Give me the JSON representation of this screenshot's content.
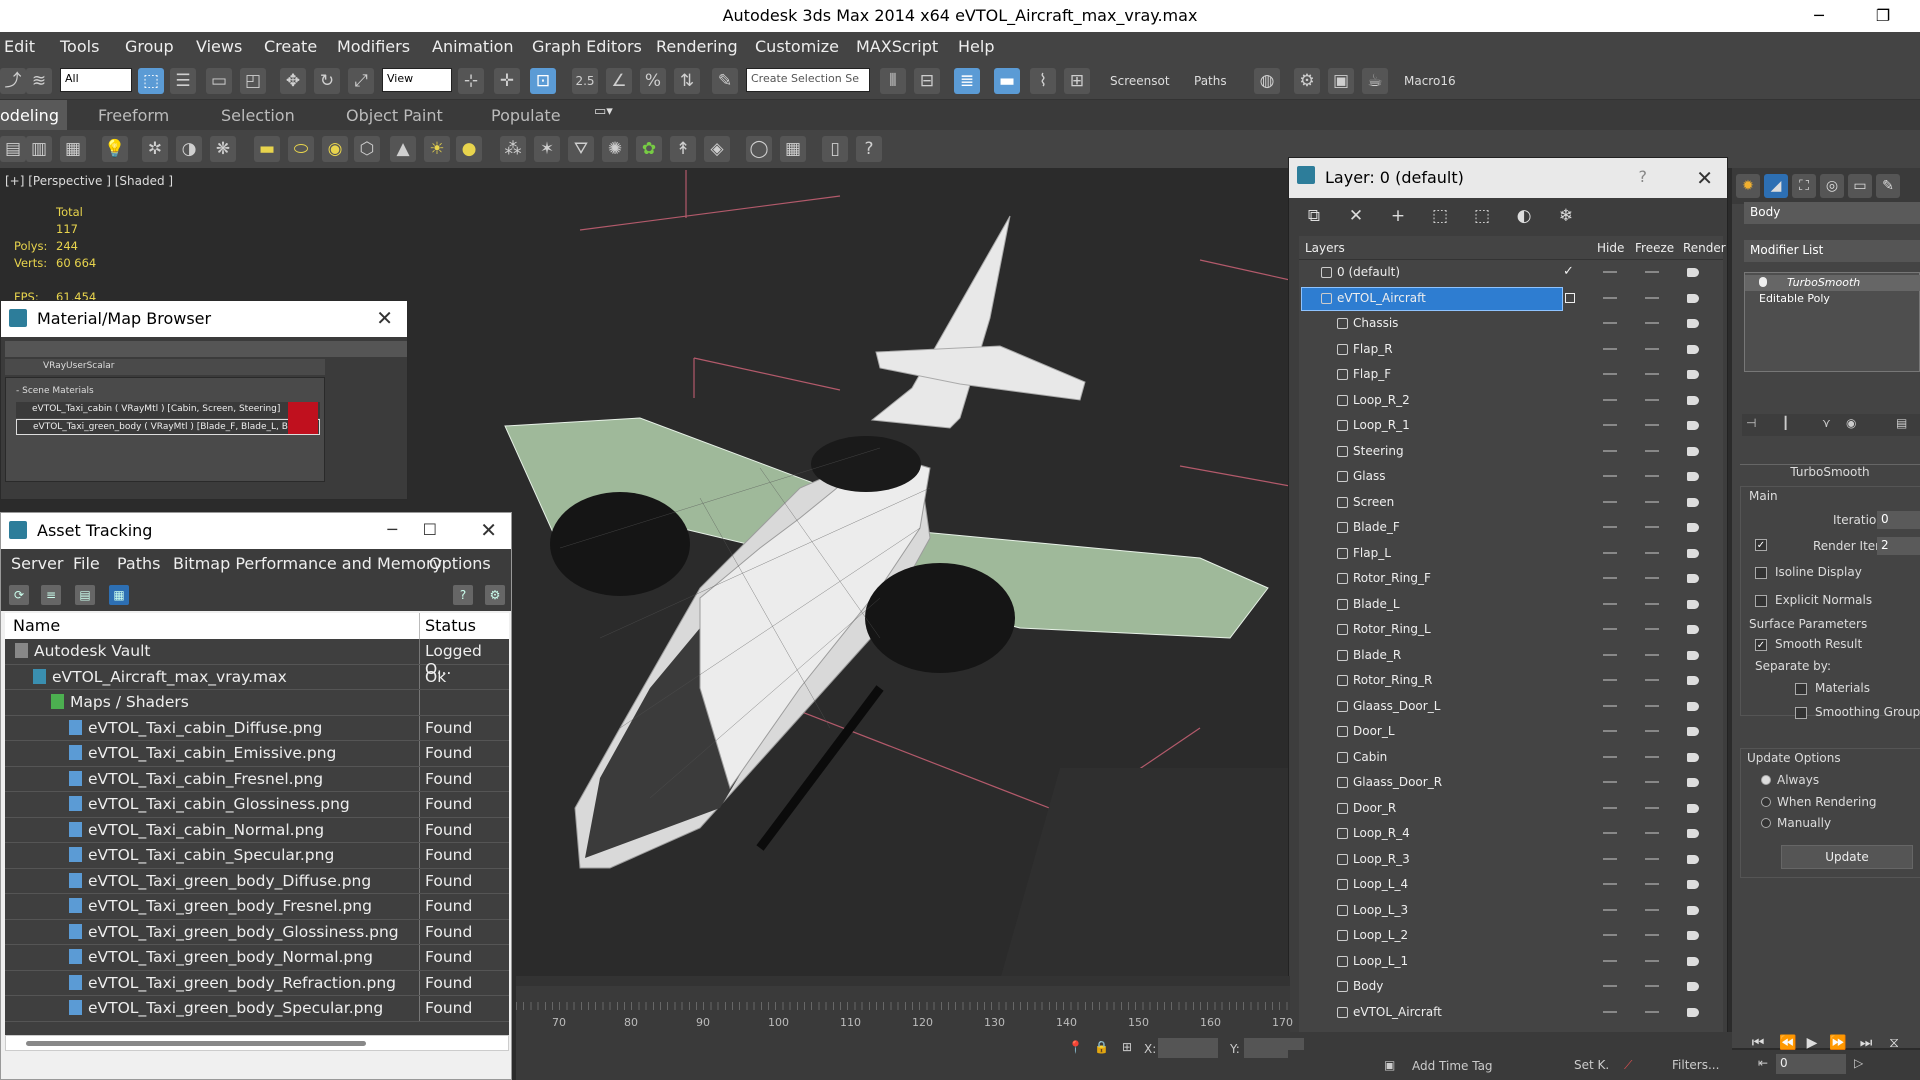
{
  "app": {
    "title": "Autodesk 3ds Max  2014 x64     eVTOL_Aircraft_max_vray.max",
    "minimize": "─",
    "maximize": "❐"
  },
  "menu": [
    "Edit",
    "Tools",
    "Group",
    "Views",
    "Create",
    "Modifiers",
    "Animation",
    "Graph Editors",
    "Rendering",
    "Customize",
    "MAXScript",
    "Help"
  ],
  "toolbar": {
    "filter_value": "All",
    "refcoord_value": "View",
    "snap_label": "2.5",
    "selection_set_placeholder": "Create Selection Se",
    "screenshot_label": "Screensot",
    "paths_label": "Paths",
    "macro_label": "Macro16"
  },
  "ribbon_tabs": [
    "odeling",
    "Freeform",
    "Selection",
    "Object Paint",
    "Populate"
  ],
  "viewport": {
    "label": "[+] [Perspective ] [Shaded ]",
    "stats_header": "Total",
    "polys_label": "Polys:",
    "polys_value": "117 244",
    "verts_label": "Verts:",
    "verts_value": "60 664",
    "fps_label": "FPS:",
    "fps_value": "61,454"
  },
  "material_browser": {
    "title": "Material/Map Browser",
    "group1_item": "VRayUserScalar",
    "group2_title": "- Scene Materials",
    "materials": [
      "eVTOL_Taxi_cabin ( VRayMtl ) [Cabin, Screen, Steering]",
      "eVTOL_Taxi_green_body ( VRayMtl ) [Blade_F, Blade_L, Blad"
    ]
  },
  "asset_tracking": {
    "title": "Asset Tracking",
    "menu": [
      "Server",
      "File",
      "Paths",
      "Bitmap Performance and Memory",
      "Options"
    ],
    "col_name": "Name",
    "col_status": "Status",
    "rows": [
      {
        "name": "Autodesk Vault",
        "status": "Logged O...",
        "indent": 0
      },
      {
        "name": "eVTOL_Aircraft_max_vray.max",
        "status": "Ok",
        "indent": 1
      },
      {
        "name": "Maps / Shaders",
        "status": "",
        "indent": 2
      },
      {
        "name": "eVTOL_Taxi_cabin_Diffuse.png",
        "status": "Found",
        "indent": 3
      },
      {
        "name": "eVTOL_Taxi_cabin_Emissive.png",
        "status": "Found",
        "indent": 3
      },
      {
        "name": "eVTOL_Taxi_cabin_Fresnel.png",
        "status": "Found",
        "indent": 3
      },
      {
        "name": "eVTOL_Taxi_cabin_Glossiness.png",
        "status": "Found",
        "indent": 3
      },
      {
        "name": "eVTOL_Taxi_cabin_Normal.png",
        "status": "Found",
        "indent": 3
      },
      {
        "name": "eVTOL_Taxi_cabin_Specular.png",
        "status": "Found",
        "indent": 3
      },
      {
        "name": "eVTOL_Taxi_green_body_Diffuse.png",
        "status": "Found",
        "indent": 3
      },
      {
        "name": "eVTOL_Taxi_green_body_Fresnel.png",
        "status": "Found",
        "indent": 3
      },
      {
        "name": "eVTOL_Taxi_green_body_Glossiness.png",
        "status": "Found",
        "indent": 3
      },
      {
        "name": "eVTOL_Taxi_green_body_Normal.png",
        "status": "Found",
        "indent": 3
      },
      {
        "name": "eVTOL_Taxi_green_body_Refraction.png",
        "status": "Found",
        "indent": 3
      },
      {
        "name": "eVTOL_Taxi_green_body_Specular.png",
        "status": "Found",
        "indent": 3
      }
    ]
  },
  "layer_window": {
    "title": "Layer: 0 (default)",
    "help": "?",
    "col_layers": "Layers",
    "col_hide": "Hide",
    "col_freeze": "Freeze",
    "col_render": "Render",
    "layers": [
      {
        "name": "0 (default)",
        "level": 0,
        "selected": false
      },
      {
        "name": "eVTOL_Aircraft",
        "level": 0,
        "selected": true
      },
      {
        "name": "Chassis",
        "level": 1
      },
      {
        "name": "Flap_R",
        "level": 1
      },
      {
        "name": "Flap_F",
        "level": 1
      },
      {
        "name": "Loop_R_2",
        "level": 1
      },
      {
        "name": "Loop_R_1",
        "level": 1
      },
      {
        "name": "Steering",
        "level": 1
      },
      {
        "name": "Glass",
        "level": 1
      },
      {
        "name": "Screen",
        "level": 1
      },
      {
        "name": "Blade_F",
        "level": 1
      },
      {
        "name": "Flap_L",
        "level": 1
      },
      {
        "name": "Rotor_Ring_F",
        "level": 1
      },
      {
        "name": "Blade_L",
        "level": 1
      },
      {
        "name": "Rotor_Ring_L",
        "level": 1
      },
      {
        "name": "Blade_R",
        "level": 1
      },
      {
        "name": "Rotor_Ring_R",
        "level": 1
      },
      {
        "name": "Glaass_Door_L",
        "level": 1
      },
      {
        "name": "Door_L",
        "level": 1
      },
      {
        "name": "Cabin",
        "level": 1
      },
      {
        "name": "Glaass_Door_R",
        "level": 1
      },
      {
        "name": "Door_R",
        "level": 1
      },
      {
        "name": "Loop_R_4",
        "level": 1
      },
      {
        "name": "Loop_R_3",
        "level": 1
      },
      {
        "name": "Loop_L_4",
        "level": 1
      },
      {
        "name": "Loop_L_3",
        "level": 1
      },
      {
        "name": "Loop_L_2",
        "level": 1
      },
      {
        "name": "Loop_L_1",
        "level": 1
      },
      {
        "name": "Body",
        "level": 1
      },
      {
        "name": "eVTOL_Aircraft",
        "level": 1
      }
    ]
  },
  "command_panel": {
    "object_name": "Body",
    "modifier_list": "Modifier List",
    "stack": [
      "TurboSmooth",
      "Editable Poly"
    ],
    "rollout_title": "TurboSmooth",
    "main_label": "Main",
    "iterations_label": "Iterations:",
    "iterations_value": "0",
    "render_iters_label": "Render Iters:",
    "render_iters_value": "2",
    "isoline_label": "Isoline Display",
    "explicit_normals_label": "Explicit Normals",
    "surface_params_label": "Surface Parameters",
    "smooth_result_label": "Smooth Result",
    "separate_by_label": "Separate by:",
    "materials_label": "Materials",
    "smoothing_groups_label": "Smoothing Groups",
    "update_options_label": "Update Options",
    "always_label": "Always",
    "when_rendering_label": "When Rendering",
    "manually_label": "Manually",
    "update_button": "Update"
  },
  "timeline": {
    "ticks": [
      "70",
      "80",
      "90",
      "100",
      "110",
      "120",
      "130",
      "140",
      "150",
      "160",
      "170"
    ]
  },
  "status": {
    "x_label": "X:",
    "y_label": "Y:",
    "add_time_tag": "Add Time Tag",
    "set_key": "Set K.",
    "filters": "Filters...",
    "frame_value": "0"
  }
}
